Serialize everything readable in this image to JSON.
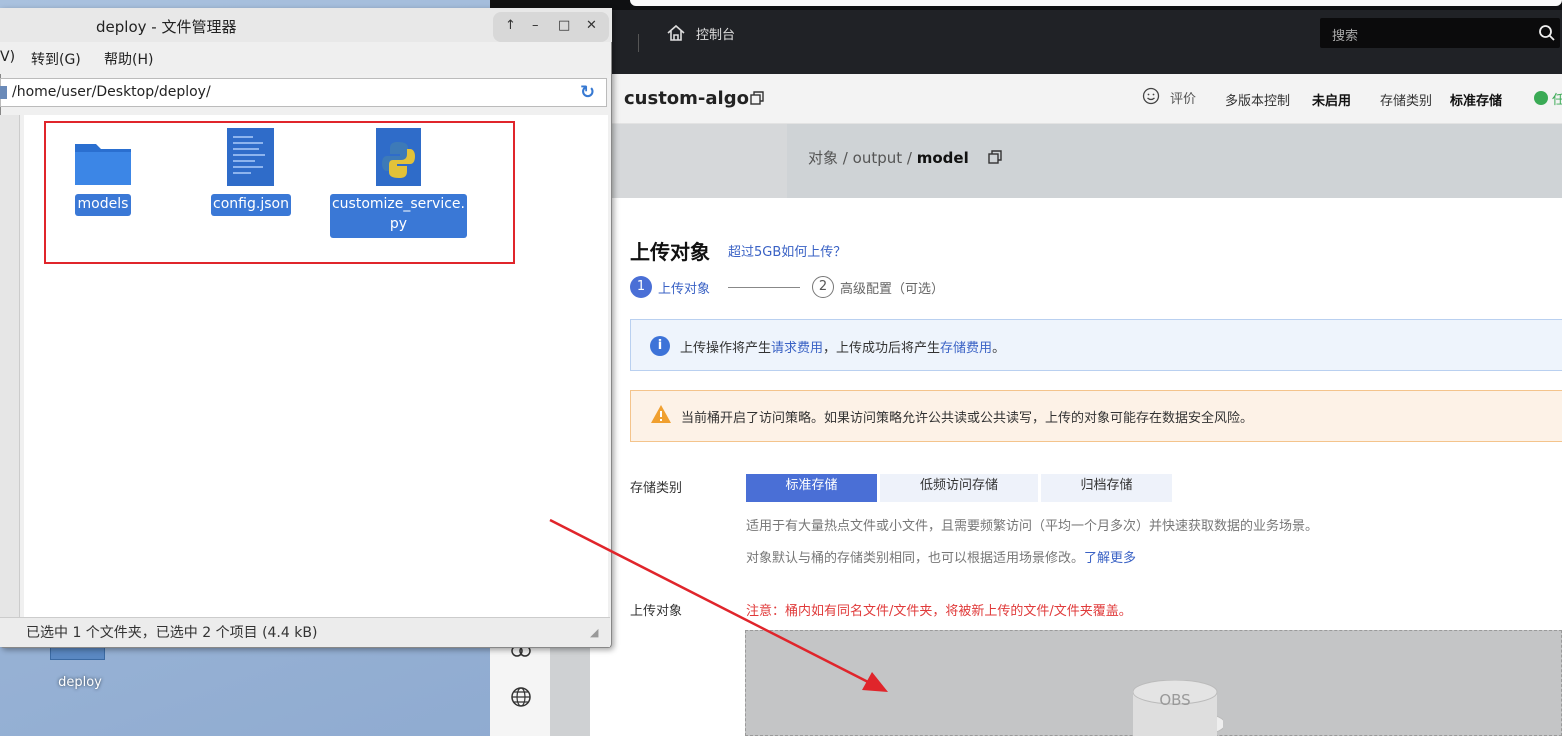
{
  "desktop": {
    "icon_label": "deploy"
  },
  "file_manager": {
    "title": "deploy - 文件管理器",
    "window_buttons": [
      "↑",
      "–",
      "□",
      "✕"
    ],
    "menu": [
      "V)",
      "转到(G)",
      "帮助(H)"
    ],
    "path": "/home/user/Desktop/deploy/",
    "files": [
      {
        "name": "models",
        "icon": "folder-icon"
      },
      {
        "name": "config.json",
        "icon": "text-file-icon"
      },
      {
        "name": "customize_service.py",
        "name_line1": "customize_service.",
        "name_line2": "py",
        "icon": "python-file-icon"
      }
    ],
    "status": "已选中 1 个文件夹，已选中 2 个项目 (4.4 kB)"
  },
  "console": {
    "home_label": "控制台",
    "search_placeholder": "搜索",
    "bucket_name": "custom-algo",
    "rate_label": "评价",
    "multiversion_label": "多版本控制",
    "multiversion_value": "未启用",
    "storage_class_label": "存储类别",
    "storage_class_value": "标准存储",
    "status_partial": "任",
    "breadcrumb": {
      "root": "对象",
      "sep": "/",
      "mid": "output",
      "current": "model"
    }
  },
  "upload_panel": {
    "title": "上传对象",
    "help_link": "超过5GB如何上传？",
    "steps": [
      {
        "num": "1",
        "label": "上传对象"
      },
      {
        "num": "2",
        "label": "高级配置（可选）"
      }
    ],
    "info_prefix": "上传操作将产生",
    "info_link1": "请求费用",
    "info_mid": "，上传成功后将产生",
    "info_link2": "存储费用",
    "info_suffix": "。",
    "warning": "当前桶开启了访问策略。如果访问策略允许公共读或公共读写，上传的对象可能存在数据安全风险。",
    "storage_label": "存储类别",
    "storage_options": [
      "标准存储",
      "低频访问存储",
      "归档存储"
    ],
    "storage_selected": "标准存储",
    "desc1": "适用于有大量热点文件或小文件，且需要频繁访问（平均一个月多次）并快速获取数据的业务场景。",
    "desc2": "对象默认与桶的存储类别相同，也可以根据适用场景修改。",
    "desc2_link": "了解更多",
    "upload_label": "上传对象",
    "upload_note": "注意：桶内如有同名文件/文件夹，将被新上传的文件/文件夹覆盖。",
    "drop_logo_text": "OBS"
  },
  "colors": {
    "accent": "#4a6fd6",
    "link": "#3a62c5",
    "warning_border": "#f4c48c",
    "annotation_red": "#e0252b"
  }
}
